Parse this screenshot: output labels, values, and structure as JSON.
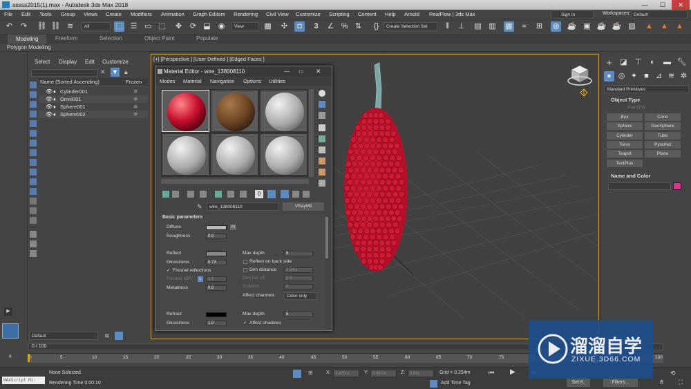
{
  "titlebar": {
    "title": "sssss2015(1).max - Autodesk 3ds Max 2018",
    "minimize": "—",
    "maximize": "☐",
    "close": "✕"
  },
  "menubar": {
    "items": [
      "File",
      "Edit",
      "Tools",
      "Group",
      "Views",
      "Create",
      "Modifiers",
      "Animation",
      "Graph Editors",
      "Rendering",
      "Civil View",
      "Customize",
      "Scripting",
      "Content",
      "Help",
      "Arnold",
      "RealFlow | 3ds Max"
    ],
    "signin": "Sign In",
    "workspaces_label": "Workspaces:",
    "workspace_value": "Default"
  },
  "toolbar": {
    "filter_value": "All",
    "view_value": "View",
    "selection_set": "Create Selection Set",
    "snap_label": "3"
  },
  "ribbon": {
    "tabs": [
      "Modeling",
      "Freeform",
      "Selection",
      "Object Paint",
      "Populate"
    ],
    "sub_label": "Polygon Modeling"
  },
  "explorer": {
    "menu": [
      "Select",
      "Display",
      "Edit",
      "Customize"
    ],
    "header_name": "Name (Sorted Ascending)",
    "header_frozen": "Frozen",
    "rows": [
      "Cylinder001",
      "Omni001",
      "Sphere001",
      "Sphere002"
    ]
  },
  "viewport": {
    "label": "[+] [Perspective ] [User Defined ] [Edged Faces ]"
  },
  "material_editor": {
    "title": "Material Editor - wire_138008110",
    "menu": [
      "Modes",
      "Material",
      "Navigation",
      "Options",
      "Utilities"
    ],
    "material_name": "wire_138008110",
    "material_type": "VRayMtl",
    "rollout": "Basic parameters",
    "diffuse": "Diffuse",
    "diffuse_map": "M",
    "roughness": "Roughness",
    "roughness_value": "0.0",
    "reflect": "Reflect",
    "glossiness": "Glossiness",
    "glossiness_value": "0.73",
    "fresnel": "Fresnel reflections",
    "fresnel_ior": "Fresnel IOR",
    "fresnel_ior_lock": "L",
    "fresnel_ior_value": "1.6",
    "metalness": "Metalness",
    "metalness_value": "0.0",
    "max_depth": "Max depth",
    "max_depth_value": "5",
    "reflect_backside": "Reflect on back side",
    "dim_distance": "Dim distance",
    "dim_distance_value": "2.54m",
    "dim_falloff": "Dim fall off",
    "dim_falloff_value": "0.0",
    "subdivs": "Subdivs",
    "subdivs_value": "8",
    "affect_channels": "Affect channels",
    "affect_channels_value": "Color only",
    "refract": "Refract",
    "refract_gloss": "Glossiness",
    "refract_gloss_value": "1.0",
    "refract_max_depth": "Max depth",
    "refract_max_depth_value": "5",
    "affect_shadows": "Affect shadows"
  },
  "command_panel": {
    "dropdown": "Standard Primitives",
    "object_type": "Object Type",
    "autogrid": "AutoGrid",
    "buttons": [
      "Box",
      "Cone",
      "Sphere",
      "GeoSphere",
      "Cylinder",
      "Tube",
      "Torus",
      "Pyramid",
      "Teapot",
      "Plane",
      "TextPlus"
    ],
    "name_color": "Name and Color"
  },
  "trackbar": {
    "layer": "Default",
    "time": "0 / 100",
    "ticks": [
      "0",
      "5",
      "10",
      "15",
      "20",
      "25",
      "30",
      "35",
      "40",
      "45",
      "50",
      "55",
      "60",
      "65",
      "70",
      "75",
      "80",
      "85",
      "90",
      "95",
      "100"
    ]
  },
  "status": {
    "maxscript": "MAXScript Mi:",
    "selection": "None Selected",
    "render_time": "Rendering Time  0:00:10",
    "x_label": "X:",
    "x_value": "8.475m",
    "y_label": "Y:",
    "y_value": "0.467m",
    "z_label": "Z:",
    "z_value": "0.0m",
    "grid": "Grid = 0.254m",
    "add_time_tag": "Add Time Tag",
    "setk": "Set K.",
    "filters": "Filters..."
  },
  "watermark": {
    "cn": "溜溜自学",
    "en": "ZIXUE.3D66.COM"
  },
  "colors": {
    "accent": "#5c8cbf",
    "viewport_border": "#c6a33a",
    "berry": "#c8102e",
    "pink_swatch": "#e03090"
  }
}
